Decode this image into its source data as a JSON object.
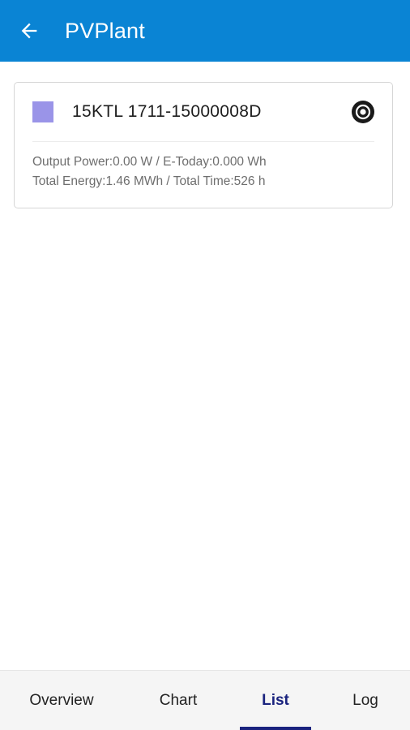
{
  "app_bar": {
    "title": "PVPlant",
    "back_icon": "arrow-left-icon",
    "background_color": "#0a84d4"
  },
  "device": {
    "name": "15KTL 1711-15000008D",
    "status_color": "#9a94e8",
    "action_icon": "target-icon",
    "line1": "Output Power:0.00 W / E-Today:0.000 Wh",
    "line2": "Total Energy:1.46 MWh / Total Time:526 h"
  },
  "bottom_nav": {
    "active_tab": "List",
    "active_color": "#1a237e",
    "tabs": [
      {
        "label": "Overview"
      },
      {
        "label": "Chart"
      },
      {
        "label": "List"
      },
      {
        "label": "Log"
      }
    ]
  }
}
